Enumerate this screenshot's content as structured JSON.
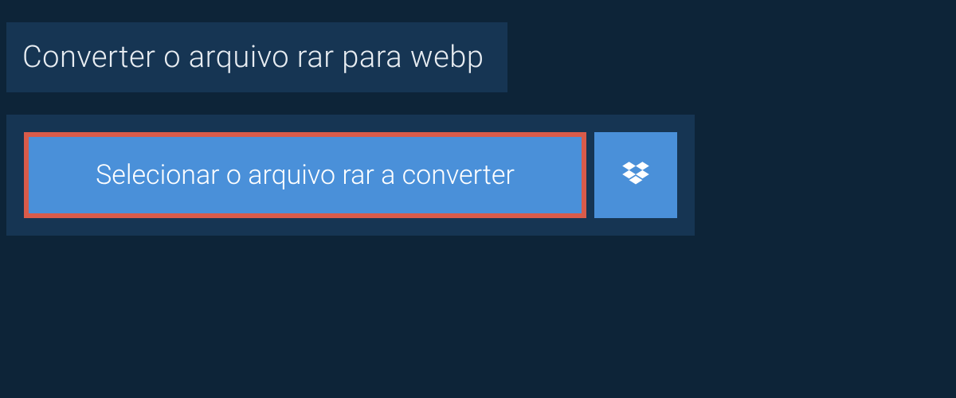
{
  "header": {
    "title": "Converter o arquivo rar para webp"
  },
  "upload": {
    "select_label": "Selecionar o arquivo rar a converter"
  }
}
